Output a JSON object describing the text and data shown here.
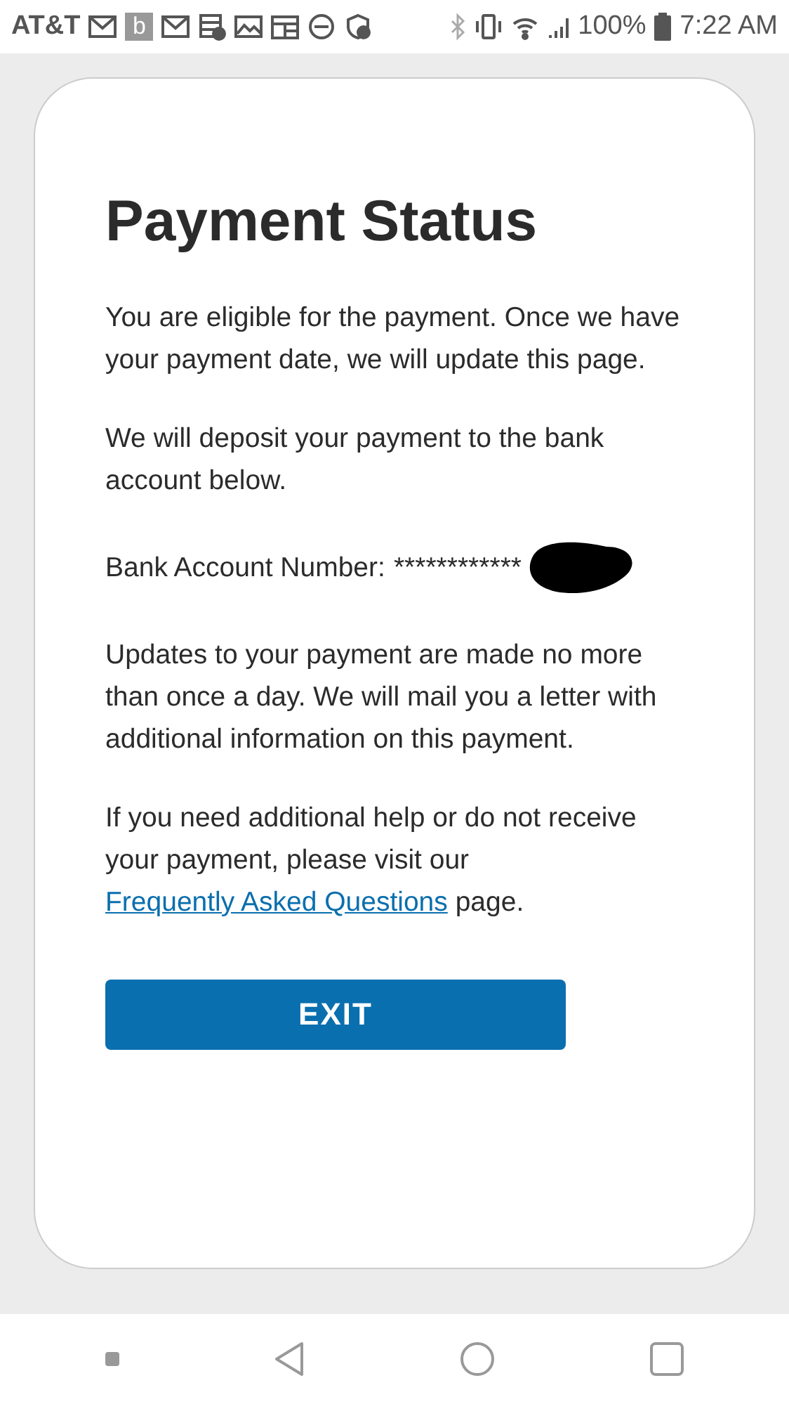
{
  "status_bar": {
    "carrier": "AT&T",
    "app_badge": "b",
    "battery": "100%",
    "time": "7:22 AM"
  },
  "card": {
    "title": "Payment Status",
    "paragraphs": [
      {
        "kind": "text",
        "text": "You are eligible for the payment. Once we have your payment date, we will update this page."
      },
      {
        "kind": "text",
        "text": "We will deposit your payment to the bank account below."
      },
      {
        "kind": "account",
        "label": "Bank Account Number:",
        "masked": "************"
      },
      {
        "kind": "text",
        "text": "Updates to your payment are made no more than once a day. We will mail you a letter with additional information on this payment."
      },
      {
        "kind": "link",
        "before": "If you need additional help or do not receive your payment, please visit our",
        "link": "Frequently Asked Questions",
        "after": "page."
      }
    ],
    "button": "EXIT"
  }
}
